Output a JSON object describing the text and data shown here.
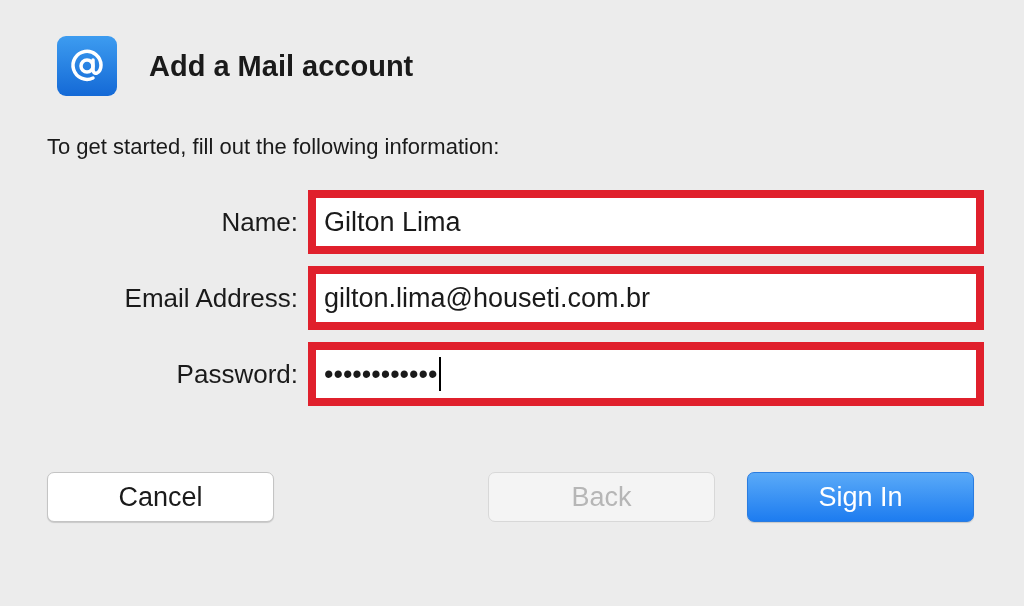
{
  "dialog": {
    "title": "Add a Mail account",
    "instructions": "To get started, fill out the following information:"
  },
  "fields": [
    {
      "label": "Name:",
      "value": "Gilton Lima",
      "highlighted": true,
      "focused": false
    },
    {
      "label": "Email Address:",
      "value": "gilton.lima@houseti.com.br",
      "highlighted": true,
      "focused": false
    },
    {
      "label": "Password:",
      "value": "••••••••••••",
      "highlighted": true,
      "focused": true
    }
  ],
  "buttons": [
    {
      "label": "Cancel",
      "kind": "normal",
      "disabled": false
    },
    {
      "label": "Back",
      "kind": "normal",
      "disabled": true
    },
    {
      "label": "Sign In",
      "kind": "primary",
      "disabled": false
    }
  ]
}
